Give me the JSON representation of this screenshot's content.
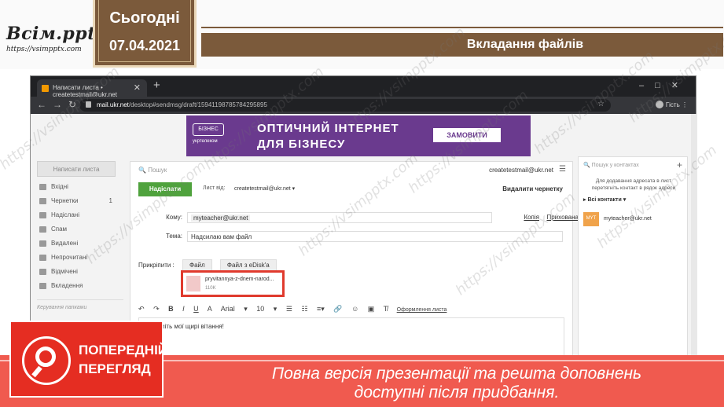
{
  "slide": {
    "logo_brand": "Всім.pptx",
    "logo_url": "https://vsimpptx.com",
    "date_label": "Сьогодні",
    "date_value": "07.04.2021",
    "title": "Вкладання файлів"
  },
  "browser": {
    "tab_title": "Написати листа • createtestmail@ukr.net",
    "url_host": "mail.ukr.net",
    "url_path": "/desktop#sendmsg/draft/15941198785784295895",
    "profile": "Гість"
  },
  "ad": {
    "badge": "БІЗНЕС",
    "provider": "укртелеком",
    "line1": "ОПТИЧНИЙ ІНТЕРНЕТ",
    "line2": "ДЛЯ БІЗНЕСУ",
    "button": "ЗАМОВИТИ"
  },
  "sidebar": {
    "compose_label": "Написати листа",
    "items": [
      {
        "label": "Вхідні",
        "count": ""
      },
      {
        "label": "Чернетки",
        "count": "1"
      },
      {
        "label": "Надіслані",
        "count": ""
      },
      {
        "label": "Спам",
        "count": ""
      },
      {
        "label": "Видалені",
        "count": ""
      },
      {
        "label": "Непрочитані",
        "count": ""
      },
      {
        "label": "Відмічені",
        "count": ""
      },
      {
        "label": "Вкладення",
        "count": ""
      }
    ],
    "manage_label": "Керування папками"
  },
  "compose": {
    "search_placeholder": "Пошук",
    "account": "createtestmail@ukr.net",
    "send_label": "Надіслати",
    "from_label": "Лист від:",
    "from_value": "createtestmail@ukr.net",
    "delete_draft": "Видалити чернетку",
    "to_label": "Кому:",
    "to_value": "myteacher@ukr.net",
    "cc_label": "Копія",
    "bcc_label": "Прихована",
    "subject_label": "Тема:",
    "subject_value": "Надсилаю вам файл",
    "attach_label": "Прикріпити :",
    "attach_file": "Файл",
    "attach_edisk": "Файл з eDisk'a",
    "file_name": "pryvitannya-z-dnem-narod...",
    "file_size": "110K",
    "font_name": "Arial",
    "font_size": "10",
    "format_link": "Оформлення листа",
    "body_text": "Прийміть мої щирі вітання!"
  },
  "contacts": {
    "search_placeholder": "Пошук у контактах",
    "hint": "Для додавання адресата в лист перетягніть контакт в рядок адреси",
    "all_label": "Всі контакти",
    "contact_initials": "MYT",
    "contact_email": "myteacher@ukr.net"
  },
  "promo": {
    "badge_line1": "ПОПЕРЕДНІЙ",
    "badge_line2": "ПЕРЕГЛЯД",
    "text_line1": "Повна версія презентації та решта доповнень",
    "text_line2": "доступні після придбання."
  },
  "colors": {
    "brown": "#7b5a3b",
    "promo_red": "#f05a4f",
    "send_green": "#4fa23d",
    "ad_purple": "#6a3a8e"
  }
}
